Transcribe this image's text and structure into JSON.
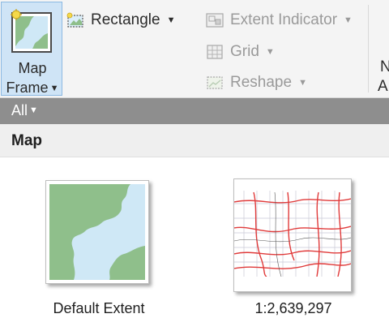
{
  "ribbon": {
    "map_frame": {
      "line1": "Map",
      "line2": "Frame",
      "icon": "map-frame-icon"
    },
    "rectangle": {
      "label": "Rectangle",
      "icon": "rectangle-icon"
    },
    "extent_indicator": {
      "label": "Extent Indicator",
      "icon": "extent-indicator-icon"
    },
    "grid": {
      "label": "Grid",
      "icon": "grid-icon"
    },
    "reshape": {
      "label": "Reshape",
      "icon": "reshape-icon"
    },
    "cut_label_1": "N",
    "cut_label_2": "A"
  },
  "filter": {
    "selected": "All"
  },
  "section": {
    "title": "Map"
  },
  "gallery": {
    "items": [
      {
        "caption": "Default Extent"
      },
      {
        "caption": "1:2,639,297"
      }
    ]
  },
  "colors": {
    "ribbon_bg": "#f4f4f4",
    "selected_button": "#cfe4f6",
    "filter_bar": "#8e8e8e",
    "land_green": "#8fbf8b",
    "water_blue": "#cfe8f6",
    "road_red": "#e03a3a"
  }
}
